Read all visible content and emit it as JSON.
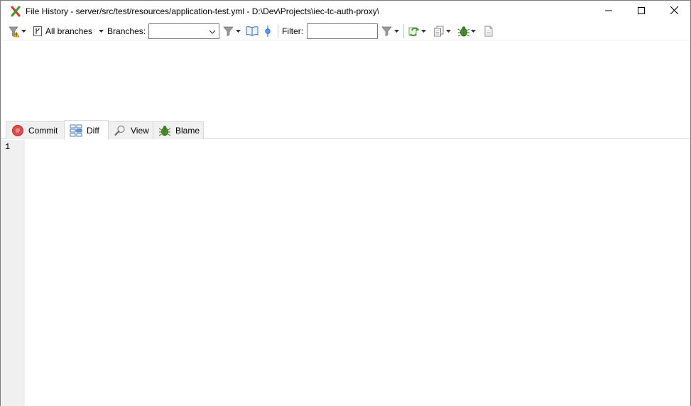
{
  "window": {
    "title": "File History - server/src/test/resources/application-test.yml - D:\\Dev\\Projects\\iec-tc-auth-proxy\\",
    "controls": {
      "minimize_icon": "minimize-icon",
      "maximize_icon": "maximize-icon",
      "close_icon": "close-icon"
    }
  },
  "toolbar": {
    "branch_selector_label": "All branches",
    "branches_label": "Branches:",
    "branches_value": "",
    "filter_label": "Filter:",
    "filter_value": "",
    "icons": [
      "filter-warning-icon",
      "branch-icon",
      "funnel-icon",
      "book-icon",
      "commit-node-icon",
      "funnel-icon",
      "refresh-icon",
      "copy-icon",
      "bug-icon",
      "page-icon"
    ]
  },
  "tabs": [
    {
      "label": "Commit",
      "icon": "commit-icon",
      "active": false
    },
    {
      "label": "Diff",
      "icon": "diff-icon",
      "active": true
    },
    {
      "label": "View",
      "icon": "magnifier-icon",
      "active": false
    },
    {
      "label": "Blame",
      "icon": "bug-icon",
      "active": false
    }
  ],
  "editor": {
    "line_numbers": [
      "1"
    ],
    "content": ""
  },
  "colors": {
    "gutter_bg": "#f0f0f0",
    "tab_bg": "#f0f0f0",
    "border": "#7a7a7a",
    "accent_green": "#3c9a2f"
  }
}
